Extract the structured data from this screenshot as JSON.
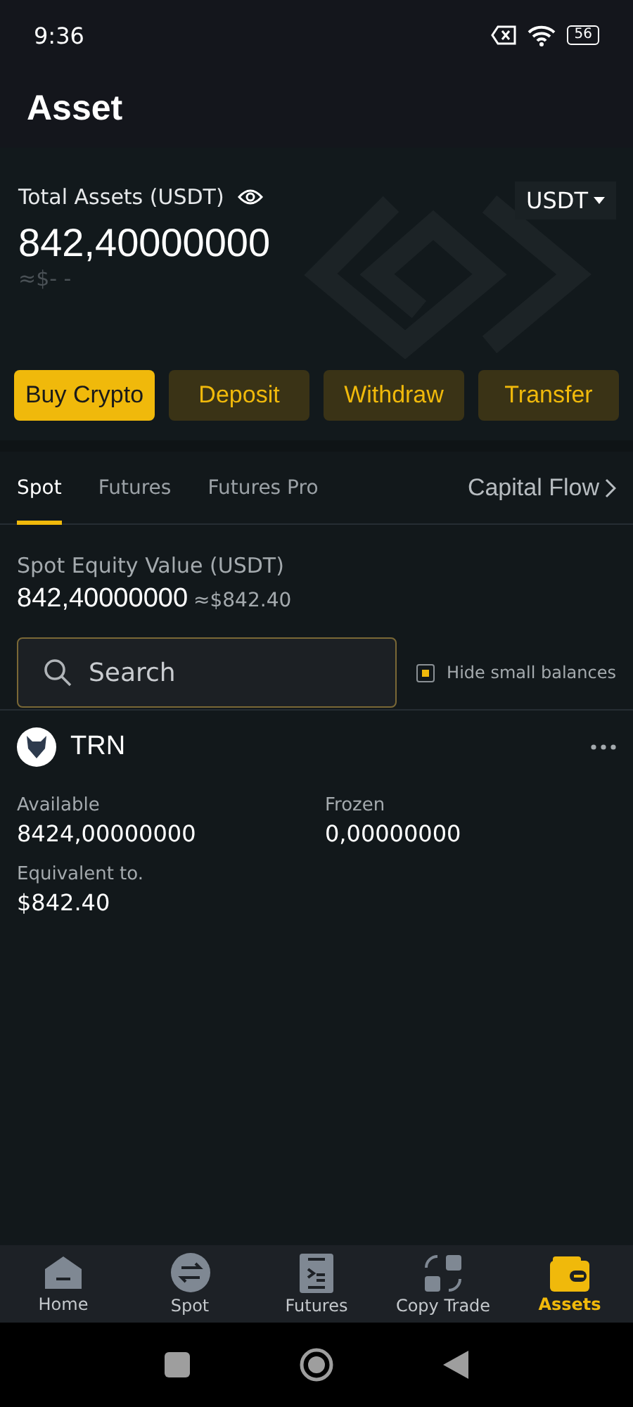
{
  "status_bar": {
    "time": "9:36",
    "battery": "56"
  },
  "header": {
    "title": "Asset"
  },
  "summary": {
    "label": "Total Assets (USDT)",
    "currency": "USDT",
    "amount": "842,40000000",
    "fiat": "≈$- -"
  },
  "actions": [
    {
      "label": "Buy Crypto",
      "kind": "primary"
    },
    {
      "label": "Deposit",
      "kind": "secondary"
    },
    {
      "label": "Withdraw",
      "kind": "secondary"
    },
    {
      "label": "Transfer",
      "kind": "secondary"
    }
  ],
  "tabs": [
    {
      "label": "Spot",
      "selected": true
    },
    {
      "label": "Futures",
      "selected": false
    },
    {
      "label": "Futures Pro",
      "selected": false
    }
  ],
  "capital_flow": "Capital Flow",
  "equity": {
    "label": "Spot Equity Value (USDT)",
    "amount": "842,40000000",
    "fiat": "≈$842.40"
  },
  "search": {
    "placeholder": "Search"
  },
  "hide_small": {
    "label": "Hide small balances",
    "checked": true
  },
  "asset": {
    "symbol": "TRN",
    "available_label": "Available",
    "available": "8424,00000000",
    "frozen_label": "Frozen",
    "frozen": "0,00000000",
    "equivalent_label": "Equivalent to.",
    "equivalent": "$842.40"
  },
  "nav": [
    {
      "label": "Home",
      "kind": "home",
      "selected": false
    },
    {
      "label": "Spot",
      "kind": "spot",
      "selected": false
    },
    {
      "label": "Futures",
      "kind": "futures",
      "selected": false
    },
    {
      "label": "Copy Trade",
      "kind": "copy",
      "selected": false
    },
    {
      "label": "Assets",
      "kind": "wallet",
      "selected": true
    }
  ]
}
